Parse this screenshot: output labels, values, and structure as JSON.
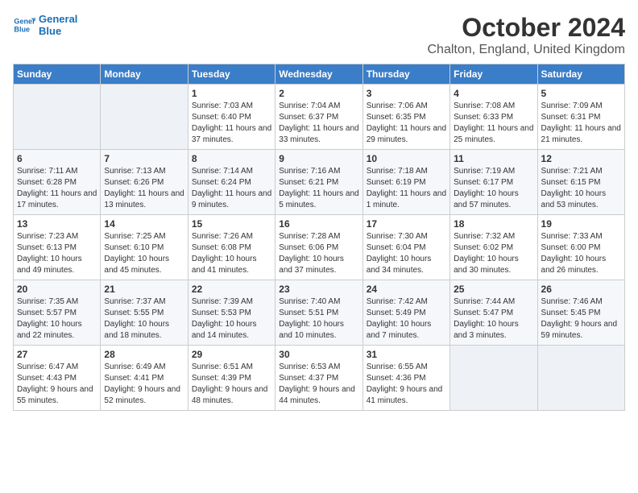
{
  "logo": {
    "line1": "General",
    "line2": "Blue"
  },
  "title": "October 2024",
  "subtitle": "Chalton, England, United Kingdom",
  "headers": [
    "Sunday",
    "Monday",
    "Tuesday",
    "Wednesday",
    "Thursday",
    "Friday",
    "Saturday"
  ],
  "weeks": [
    [
      {
        "day": "",
        "content": ""
      },
      {
        "day": "",
        "content": ""
      },
      {
        "day": "1",
        "content": "Sunrise: 7:03 AM\nSunset: 6:40 PM\nDaylight: 11 hours and 37 minutes."
      },
      {
        "day": "2",
        "content": "Sunrise: 7:04 AM\nSunset: 6:37 PM\nDaylight: 11 hours and 33 minutes."
      },
      {
        "day": "3",
        "content": "Sunrise: 7:06 AM\nSunset: 6:35 PM\nDaylight: 11 hours and 29 minutes."
      },
      {
        "day": "4",
        "content": "Sunrise: 7:08 AM\nSunset: 6:33 PM\nDaylight: 11 hours and 25 minutes."
      },
      {
        "day": "5",
        "content": "Sunrise: 7:09 AM\nSunset: 6:31 PM\nDaylight: 11 hours and 21 minutes."
      }
    ],
    [
      {
        "day": "6",
        "content": "Sunrise: 7:11 AM\nSunset: 6:28 PM\nDaylight: 11 hours and 17 minutes."
      },
      {
        "day": "7",
        "content": "Sunrise: 7:13 AM\nSunset: 6:26 PM\nDaylight: 11 hours and 13 minutes."
      },
      {
        "day": "8",
        "content": "Sunrise: 7:14 AM\nSunset: 6:24 PM\nDaylight: 11 hours and 9 minutes."
      },
      {
        "day": "9",
        "content": "Sunrise: 7:16 AM\nSunset: 6:21 PM\nDaylight: 11 hours and 5 minutes."
      },
      {
        "day": "10",
        "content": "Sunrise: 7:18 AM\nSunset: 6:19 PM\nDaylight: 11 hours and 1 minute."
      },
      {
        "day": "11",
        "content": "Sunrise: 7:19 AM\nSunset: 6:17 PM\nDaylight: 10 hours and 57 minutes."
      },
      {
        "day": "12",
        "content": "Sunrise: 7:21 AM\nSunset: 6:15 PM\nDaylight: 10 hours and 53 minutes."
      }
    ],
    [
      {
        "day": "13",
        "content": "Sunrise: 7:23 AM\nSunset: 6:13 PM\nDaylight: 10 hours and 49 minutes."
      },
      {
        "day": "14",
        "content": "Sunrise: 7:25 AM\nSunset: 6:10 PM\nDaylight: 10 hours and 45 minutes."
      },
      {
        "day": "15",
        "content": "Sunrise: 7:26 AM\nSunset: 6:08 PM\nDaylight: 10 hours and 41 minutes."
      },
      {
        "day": "16",
        "content": "Sunrise: 7:28 AM\nSunset: 6:06 PM\nDaylight: 10 hours and 37 minutes."
      },
      {
        "day": "17",
        "content": "Sunrise: 7:30 AM\nSunset: 6:04 PM\nDaylight: 10 hours and 34 minutes."
      },
      {
        "day": "18",
        "content": "Sunrise: 7:32 AM\nSunset: 6:02 PM\nDaylight: 10 hours and 30 minutes."
      },
      {
        "day": "19",
        "content": "Sunrise: 7:33 AM\nSunset: 6:00 PM\nDaylight: 10 hours and 26 minutes."
      }
    ],
    [
      {
        "day": "20",
        "content": "Sunrise: 7:35 AM\nSunset: 5:57 PM\nDaylight: 10 hours and 22 minutes."
      },
      {
        "day": "21",
        "content": "Sunrise: 7:37 AM\nSunset: 5:55 PM\nDaylight: 10 hours and 18 minutes."
      },
      {
        "day": "22",
        "content": "Sunrise: 7:39 AM\nSunset: 5:53 PM\nDaylight: 10 hours and 14 minutes."
      },
      {
        "day": "23",
        "content": "Sunrise: 7:40 AM\nSunset: 5:51 PM\nDaylight: 10 hours and 10 minutes."
      },
      {
        "day": "24",
        "content": "Sunrise: 7:42 AM\nSunset: 5:49 PM\nDaylight: 10 hours and 7 minutes."
      },
      {
        "day": "25",
        "content": "Sunrise: 7:44 AM\nSunset: 5:47 PM\nDaylight: 10 hours and 3 minutes."
      },
      {
        "day": "26",
        "content": "Sunrise: 7:46 AM\nSunset: 5:45 PM\nDaylight: 9 hours and 59 minutes."
      }
    ],
    [
      {
        "day": "27",
        "content": "Sunrise: 6:47 AM\nSunset: 4:43 PM\nDaylight: 9 hours and 55 minutes."
      },
      {
        "day": "28",
        "content": "Sunrise: 6:49 AM\nSunset: 4:41 PM\nDaylight: 9 hours and 52 minutes."
      },
      {
        "day": "29",
        "content": "Sunrise: 6:51 AM\nSunset: 4:39 PM\nDaylight: 9 hours and 48 minutes."
      },
      {
        "day": "30",
        "content": "Sunrise: 6:53 AM\nSunset: 4:37 PM\nDaylight: 9 hours and 44 minutes."
      },
      {
        "day": "31",
        "content": "Sunrise: 6:55 AM\nSunset: 4:36 PM\nDaylight: 9 hours and 41 minutes."
      },
      {
        "day": "",
        "content": ""
      },
      {
        "day": "",
        "content": ""
      }
    ]
  ]
}
